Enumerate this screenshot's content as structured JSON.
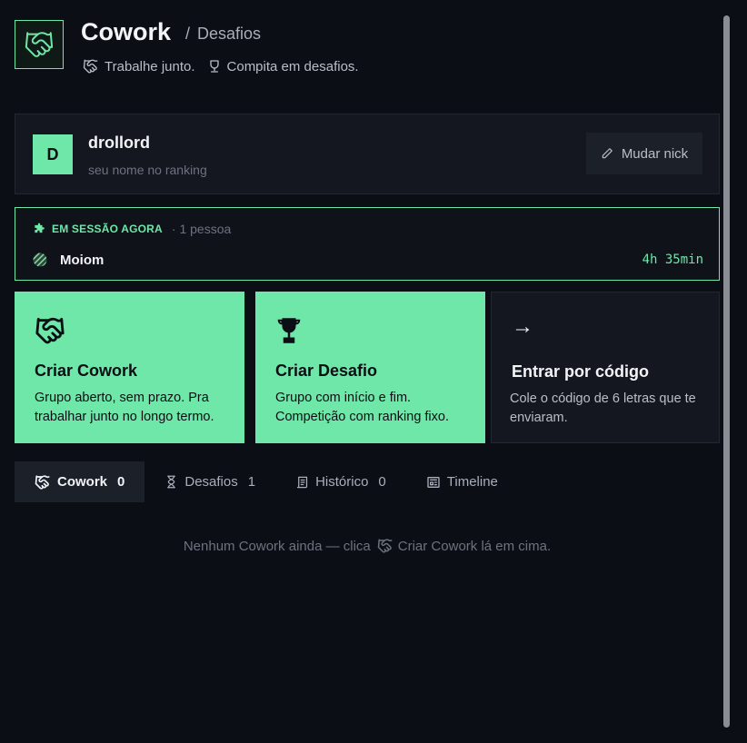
{
  "header": {
    "title": "Cowork",
    "crumb_sep": "/",
    "crumb": "Desafios",
    "tagline_1": "Trabalhe junto.",
    "tagline_2": "Compita em desafios."
  },
  "user": {
    "avatar_letter": "D",
    "nick": "drollord",
    "subtitle": "seu nome no ranking",
    "change_nick_label": "Mudar nick"
  },
  "session": {
    "label": "EM SESSÃO AGORA",
    "count": "· 1 pessoa",
    "user": "Moiom",
    "duration": "4h 35min"
  },
  "actions": [
    {
      "title": "Criar Cowork",
      "desc": "Grupo aberto, sem prazo. Pra trabalhar junto no longo termo.",
      "icon": "handshake-icon"
    },
    {
      "title": "Criar Desafio",
      "desc": "Grupo com início e fim. Competição com ranking fixo.",
      "icon": "trophy-icon"
    },
    {
      "title": "Entrar por código",
      "desc": "Cole o código de 6 letras que te enviaram.",
      "icon": "→"
    }
  ],
  "tabs": [
    {
      "label": "Cowork",
      "count": "0",
      "icon": "handshake-icon",
      "active": true
    },
    {
      "label": "Desafios",
      "count": "1",
      "icon": "trophy-icon"
    },
    {
      "label": "Histórico",
      "count": "0",
      "icon": "scroll-icon"
    },
    {
      "label": "Timeline",
      "icon": "newspaper-icon"
    }
  ],
  "empty": {
    "before": "Nenhum Cowork ainda — clica",
    "after": "Criar Cowork lá em cima."
  },
  "colors": {
    "accent": "#6ee7a8",
    "background": "#0c0e15",
    "card": "#141720"
  }
}
